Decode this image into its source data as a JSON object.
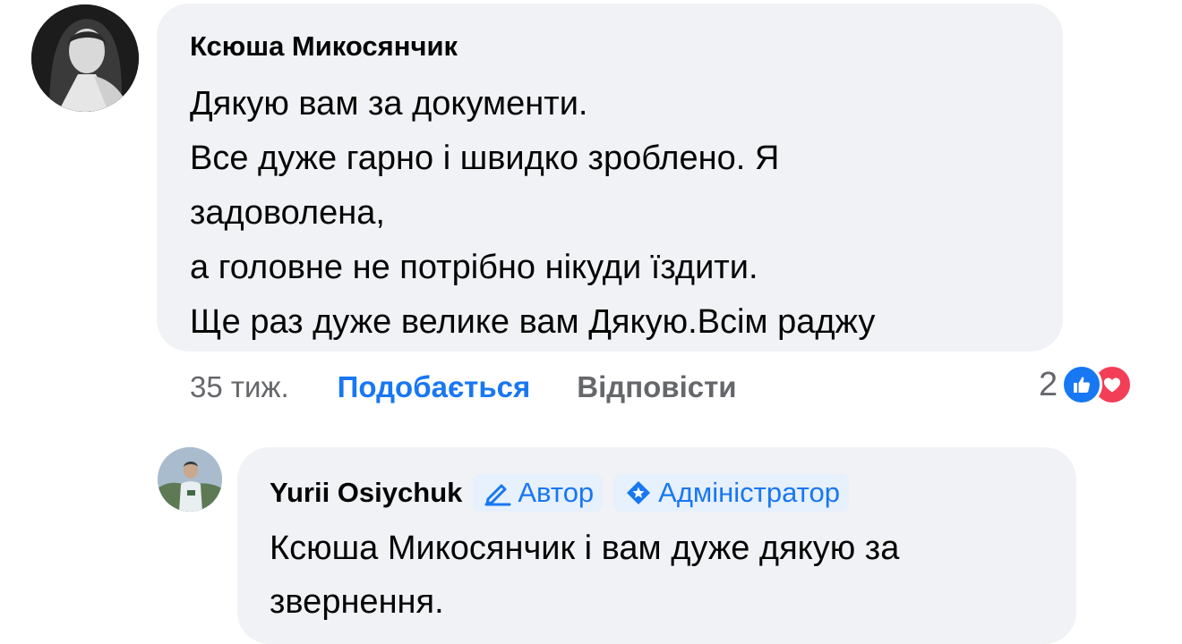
{
  "comment": {
    "author": "Ксюша Микосянчик",
    "lines": [
      "Дякую вам за документи.",
      "Все дуже гарно і швидко зроблено. Я",
      "задоволена,",
      "а головне не потрібно нікуди їздити.",
      "Ще раз дуже велике вам Дякую.Всім раджу"
    ],
    "time": "35 тиж.",
    "like_label": "Подобається",
    "reply_label": "Відповісти",
    "reaction_count": "2",
    "reactions": [
      "like-icon",
      "love-icon"
    ]
  },
  "reply": {
    "author": "Yurii Osiychuk",
    "badges": {
      "author": "Автор",
      "admin": "Адміністратор"
    },
    "text": "Ксюша Микосянчик і вам дуже дякую за звернення."
  },
  "colors": {
    "bubble": "#f0f2f5",
    "accent": "#1877f2",
    "muted": "#65676b",
    "love": "#f33e58",
    "badge_bg": "#e7f0fd"
  }
}
